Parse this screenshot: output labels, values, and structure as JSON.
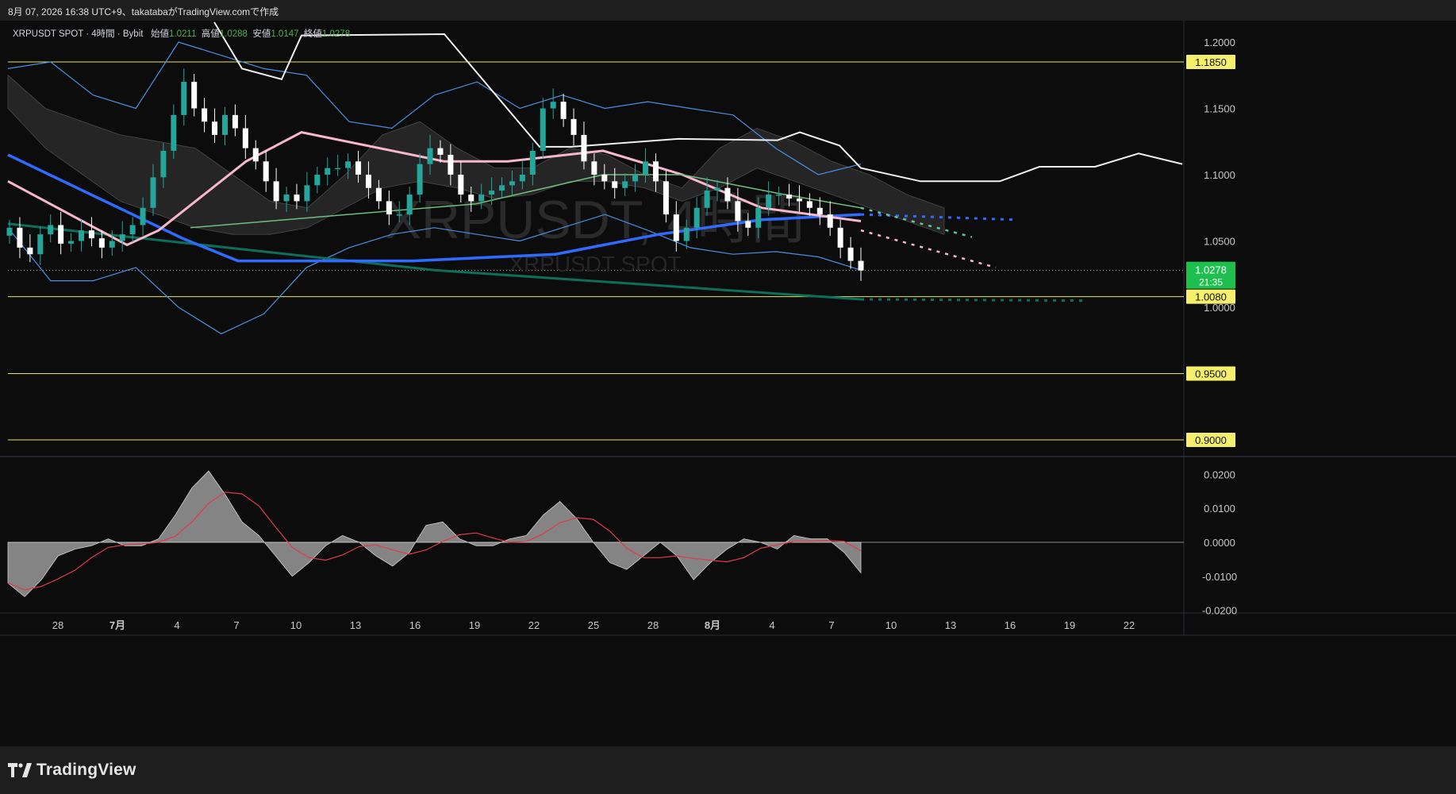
{
  "header": {
    "caption": "8月 07, 2026 16:38 UTC+9、takatabaがTradingView.comで作成"
  },
  "legend": {
    "symbol_line": "XRPUSDT SPOT · 4時間 · Bybit",
    "open_label": "始値",
    "open": "1.0211",
    "high_label": "高値",
    "high": "1.0288",
    "low_label": "安値",
    "low": "1.0147",
    "close_label": "終値",
    "close": "1.0278"
  },
  "watermark": {
    "main": "XRPUSDT, 4時間",
    "sub": "XRPUSDT SPOT"
  },
  "footer": {
    "brand": "TradingView"
  },
  "colors": {
    "up": "#26a69a",
    "down": "#ffffff",
    "level_line": "#e8e64a",
    "sma_blue": "#2f6bff",
    "sma_pink": "#f8b8cc",
    "sma_green": "#0d6e5a",
    "bb": "#4a8fe0",
    "cloud": "#555555",
    "span_white": "#f0f0f0",
    "last_price": "#1fbf4f"
  },
  "chart_data": [
    {
      "type": "candlestick",
      "timeframe": "4h",
      "ylim": [
        0.98,
        1.21
      ],
      "y_ticks": [
        "1.2000",
        "1.1500",
        "1.1000",
        "1.0500",
        "1.0000"
      ],
      "x_ticks": [
        "28",
        "7月",
        "4",
        "7",
        "10",
        "13",
        "16",
        "19",
        "22",
        "25",
        "28",
        "8月",
        "4",
        "7",
        "10",
        "13",
        "16",
        "19",
        "22"
      ],
      "horizontal_levels": [
        "1.1850",
        "1.0080",
        "0.9500",
        "0.9000"
      ],
      "last_price": "1.0278",
      "countdown": "21:35",
      "closes": [
        1.06,
        1.045,
        1.04,
        1.055,
        1.062,
        1.048,
        1.05,
        1.058,
        1.052,
        1.045,
        1.05,
        1.055,
        1.062,
        1.075,
        1.098,
        1.118,
        1.145,
        1.17,
        1.15,
        1.14,
        1.13,
        1.145,
        1.135,
        1.12,
        1.11,
        1.095,
        1.08,
        1.085,
        1.08,
        1.092,
        1.1,
        1.105,
        1.105,
        1.11,
        1.1,
        1.09,
        1.08,
        1.07,
        1.07,
        1.085,
        1.108,
        1.12,
        1.115,
        1.1,
        1.085,
        1.08,
        1.085,
        1.088,
        1.092,
        1.095,
        1.1,
        1.118,
        1.15,
        1.155,
        1.142,
        1.13,
        1.11,
        1.1,
        1.095,
        1.09,
        1.095,
        1.1,
        1.11,
        1.095,
        1.07,
        1.05,
        1.06,
        1.075,
        1.088,
        1.09,
        1.08,
        1.065,
        1.06,
        1.075,
        1.085,
        1.085,
        1.082,
        1.08,
        1.075,
        1.07,
        1.06,
        1.045,
        1.035,
        1.0278
      ],
      "series": [
        {
          "name": "",
          "role": "sma_long_green",
          "values": [
            1.063,
            1.028,
            1.006
          ]
        },
        {
          "name": "",
          "role": "sma_mid_blue",
          "values": [
            1.115,
            1.052,
            1.035,
            1.035,
            1.04,
            1.055,
            1.066,
            1.07
          ]
        },
        {
          "name": "",
          "role": "sma_short_pink",
          "values": [
            1.095,
            1.047,
            1.058,
            1.11,
            1.132,
            1.11,
            1.11,
            1.118,
            1.1,
            1.075,
            1.065
          ]
        }
      ]
    },
    {
      "type": "area",
      "name": "",
      "ylim": [
        -0.022,
        0.022
      ],
      "y_ticks": [
        "0.0200",
        "0.0100",
        "0.0000",
        "-0.0100",
        "-0.0200"
      ],
      "values": [
        -0.012,
        -0.016,
        -0.011,
        -0.004,
        -0.002,
        -0.001,
        0.001,
        -0.001,
        -0.001,
        0.001,
        0.008,
        0.016,
        0.021,
        0.014,
        0.006,
        0.002,
        -0.004,
        -0.01,
        -0.006,
        -0.001,
        0.002,
        0.0,
        -0.004,
        -0.007,
        -0.003,
        0.005,
        0.006,
        0.001,
        -0.001,
        -0.001,
        0.001,
        0.002,
        0.008,
        0.012,
        0.007,
        0.0,
        -0.006,
        -0.008,
        -0.004,
        0.0,
        -0.004,
        -0.011,
        -0.006,
        -0.002,
        0.001,
        0.0,
        -0.002,
        0.002,
        0.001,
        0.001,
        -0.003,
        -0.009
      ]
    }
  ]
}
